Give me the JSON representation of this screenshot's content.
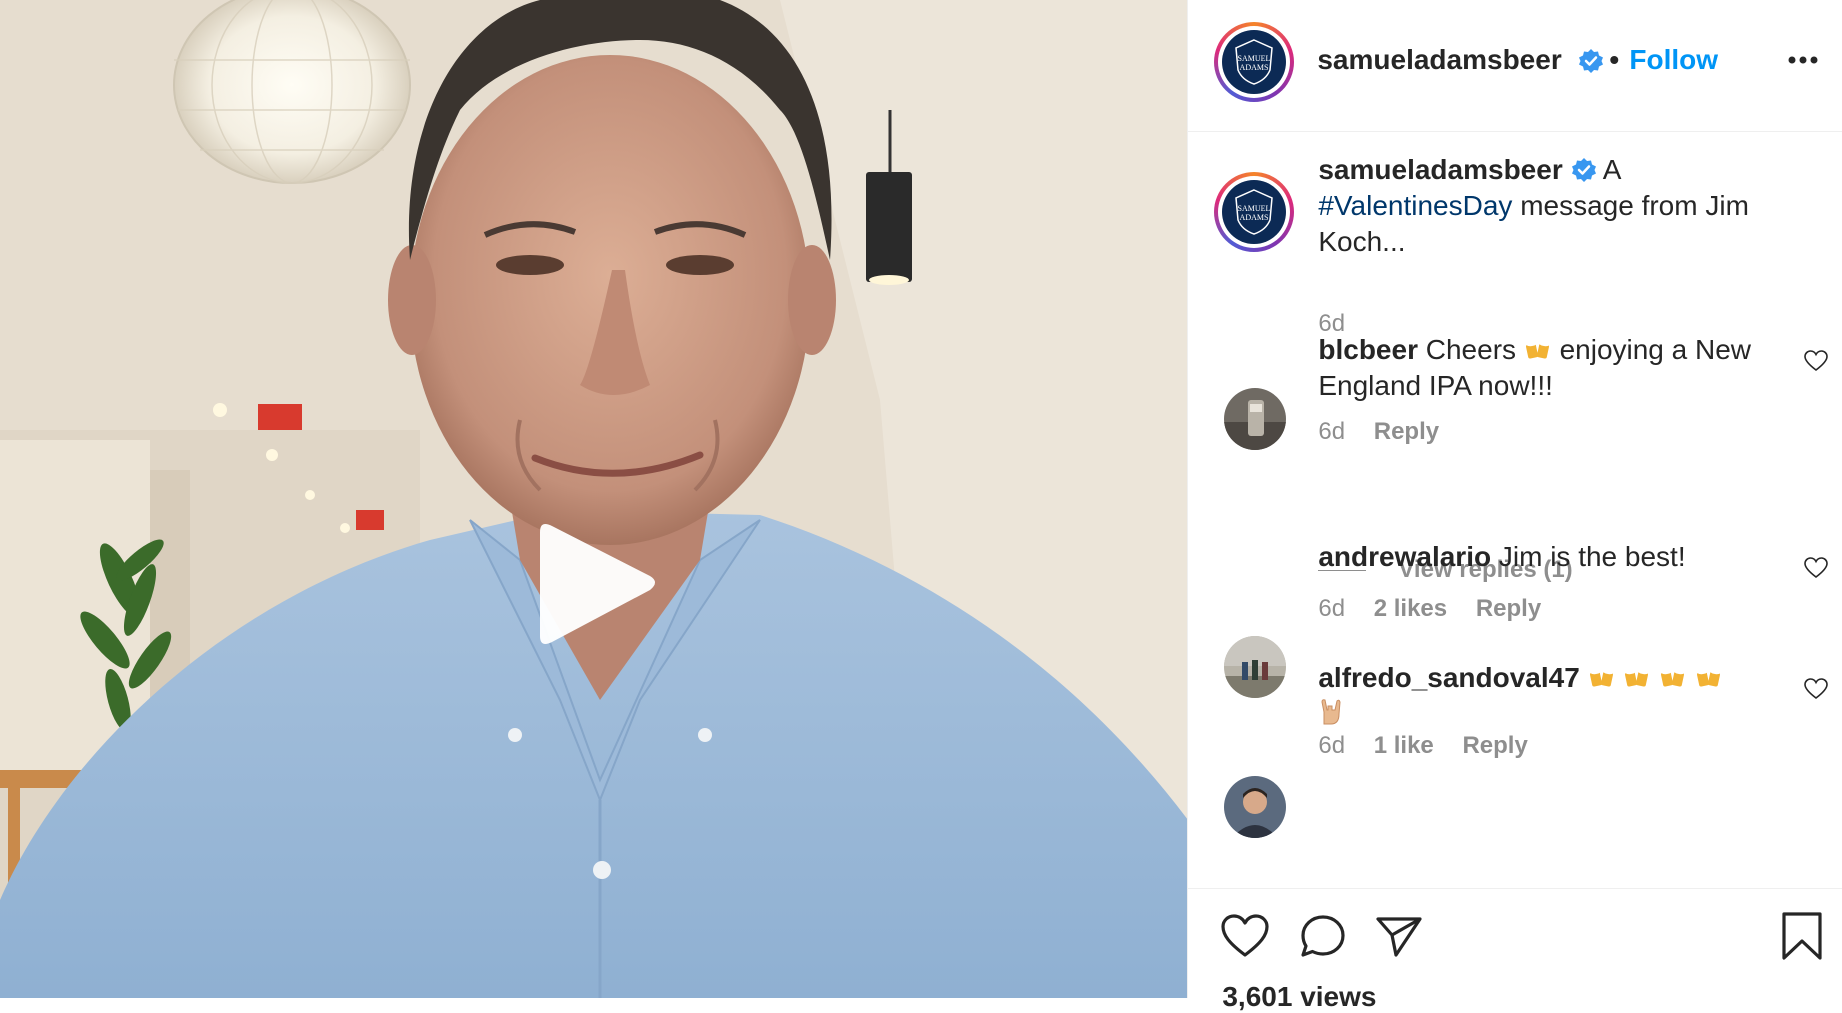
{
  "post": {
    "username": "samueladamsbeer",
    "follow_label": "Follow",
    "logo_text_line1": "SAMUEL",
    "logo_text_line2": "ADAMS"
  },
  "caption": {
    "username": "samueladamsbeer",
    "text_before": "A",
    "hashtag": "#ValentinesDay",
    "text_after": "message from Jim Koch...",
    "time": "6d"
  },
  "comments": [
    {
      "username": "blcbeer",
      "text_before": "Cheers",
      "text_after": "enjoying a New England IPA now!!!",
      "time": "6d",
      "reply_label": "Reply"
    },
    {
      "username": "andrewalario",
      "text": "Jim is the best!",
      "time": "6d",
      "likes": "2 likes",
      "reply_label": "Reply"
    },
    {
      "username": "alfredo_sandoval47",
      "time": "6d",
      "likes": "1 like",
      "reply_label": "Reply"
    }
  ],
  "view_replies_label": "View replies (1)",
  "views": "3,601 views",
  "icons": {
    "play": "play-icon",
    "like": "heart-icon",
    "comment": "comment-icon",
    "share": "paper-plane-icon",
    "save": "bookmark-icon",
    "more": "more-horizontal-icon"
  },
  "colors": {
    "link": "#0095f6",
    "hashtag": "#00376b",
    "secondary_text": "#8e8e8e",
    "verified": "#3897f0"
  }
}
